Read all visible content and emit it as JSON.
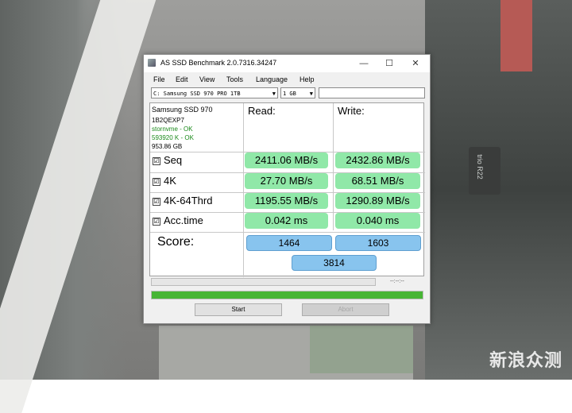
{
  "window": {
    "title": "AS SSD Benchmark 2.0.7316.34247",
    "controls": {
      "minimize": "—",
      "maximize": "☐",
      "close": "✕"
    }
  },
  "menu": [
    "File",
    "Edit",
    "View",
    "Tools",
    "Language",
    "Help"
  ],
  "drive_select": {
    "value": "C: Samsung SSD 970 PRO 1TB"
  },
  "size_select": {
    "value": "1 GB"
  },
  "info": {
    "model": "Samsung SSD 970",
    "firmware": "1B2QEXP7",
    "driver": "stornvme - OK",
    "alignment": "593920 K - OK",
    "capacity": "953.86 GB"
  },
  "headers": {
    "read": "Read:",
    "write": "Write:"
  },
  "rows": [
    {
      "label": "Seq",
      "read": "2411.06 MB/s",
      "write": "2432.86 MB/s",
      "checked": "☑"
    },
    {
      "label": "4K",
      "read": "27.70 MB/s",
      "write": "68.51 MB/s",
      "checked": "☑"
    },
    {
      "label": "4K-64Thrd",
      "read": "1195.55 MB/s",
      "write": "1290.89 MB/s",
      "checked": "☑"
    },
    {
      "label": "Acc.time",
      "read": "0.042 ms",
      "write": "0.040 ms",
      "checked": "☑"
    }
  ],
  "score": {
    "label": "Score:",
    "read": "1464",
    "write": "1603",
    "total": "3814"
  },
  "progress": {
    "time": "--:--:--",
    "overall_fraction": 1.0
  },
  "buttons": {
    "start": "Start",
    "abort": "Abort"
  },
  "watermark": "新浪众测",
  "background_chip_label": "trio R22",
  "colors": {
    "value_cell": "#90e8a8",
    "score_cell": "#88c4ee",
    "progress": "#47b535"
  }
}
